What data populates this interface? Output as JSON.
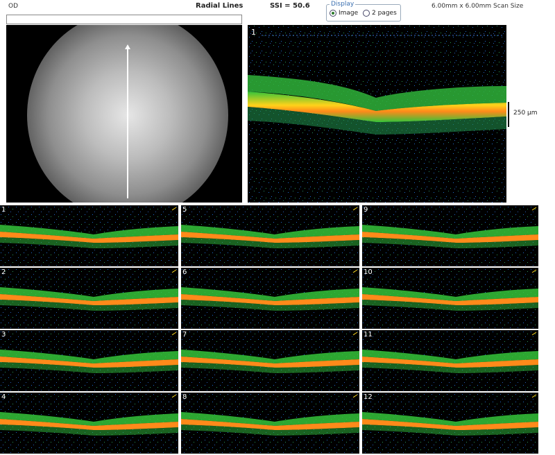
{
  "header": {
    "eye": "OD",
    "scan_type": "Radial Lines",
    "ssi": "SSI = 50.6",
    "scan_size": "6.00mm x 6.00mm Scan Size",
    "display": {
      "legend": "Display",
      "options": [
        {
          "label": "Image",
          "checked": true
        },
        {
          "label": "2 pages",
          "checked": false
        }
      ]
    }
  },
  "main_scan": {
    "number": "1",
    "scale_label": "250 µm"
  },
  "thumbnails": [
    "1",
    "5",
    "9",
    "2",
    "6",
    "10",
    "3",
    "7",
    "11",
    "4",
    "8",
    "12"
  ],
  "colors": {
    "background": "#000000",
    "retina_green": "#35c43a",
    "rpe_orange": "#ff8a1a",
    "rpe_yellow": "#ffd21a",
    "noise_blue": "#1f6fd0",
    "divider": "#ffffff"
  }
}
